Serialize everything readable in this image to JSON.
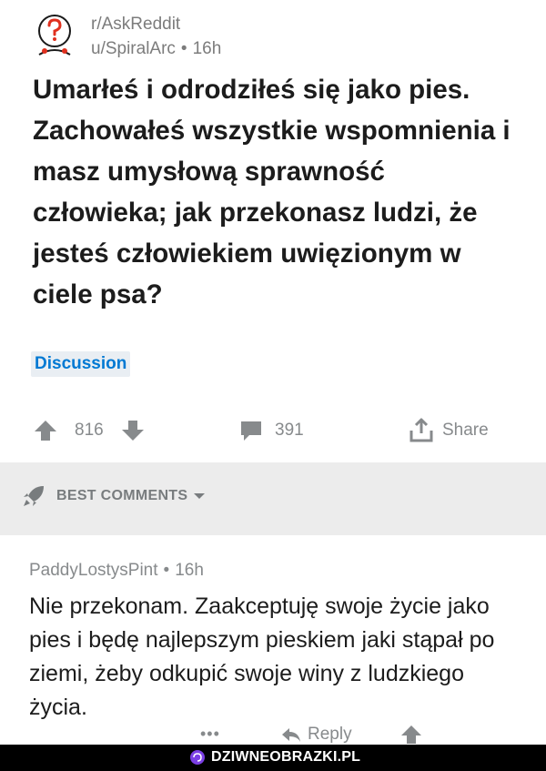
{
  "post": {
    "subreddit": "r/AskReddit",
    "author": "u/SpiralArc",
    "time": "16h",
    "title": "Umarłeś i odrodziłeś się jako pies. Zachowałeś  wszystkie wspomnienia i masz umysłową sprawność człowieka; jak przekonasz ludzi, że jesteś człowiekiem uwięzionym w ciele psa?",
    "flair": "Discussion",
    "upvotes": "816",
    "comments": "391",
    "share_label": "Share",
    "icons": {
      "avatar": "snoo-question-avatar",
      "upvote": "up-arrow-icon",
      "downvote": "down-arrow-icon",
      "comments": "comment-bubble-icon",
      "share": "share-icon"
    }
  },
  "sort": {
    "label": "BEST COMMENTS",
    "icons": {
      "rocket": "rocket-icon",
      "chevron": "chevron-down-icon"
    }
  },
  "comment": {
    "author": "PaddyLostysPint",
    "time": "16h",
    "body": "Nie przekonam. Zaakceptuję swoje życie jako pies i będę najlepszym pieskiem jaki stąpał po ziemi, żeby odkupić swoje winy z ludzkiego życia.",
    "more_label": "•••",
    "reply_label": "Reply"
  },
  "watermark": {
    "text": "DZIWNEOBRAZKI.PL"
  },
  "colors": {
    "accent": "#0079d3",
    "muted": "#878a8c",
    "separator": "#ececec",
    "footer": "#000000",
    "logo_purple": "#7b3fe4"
  }
}
